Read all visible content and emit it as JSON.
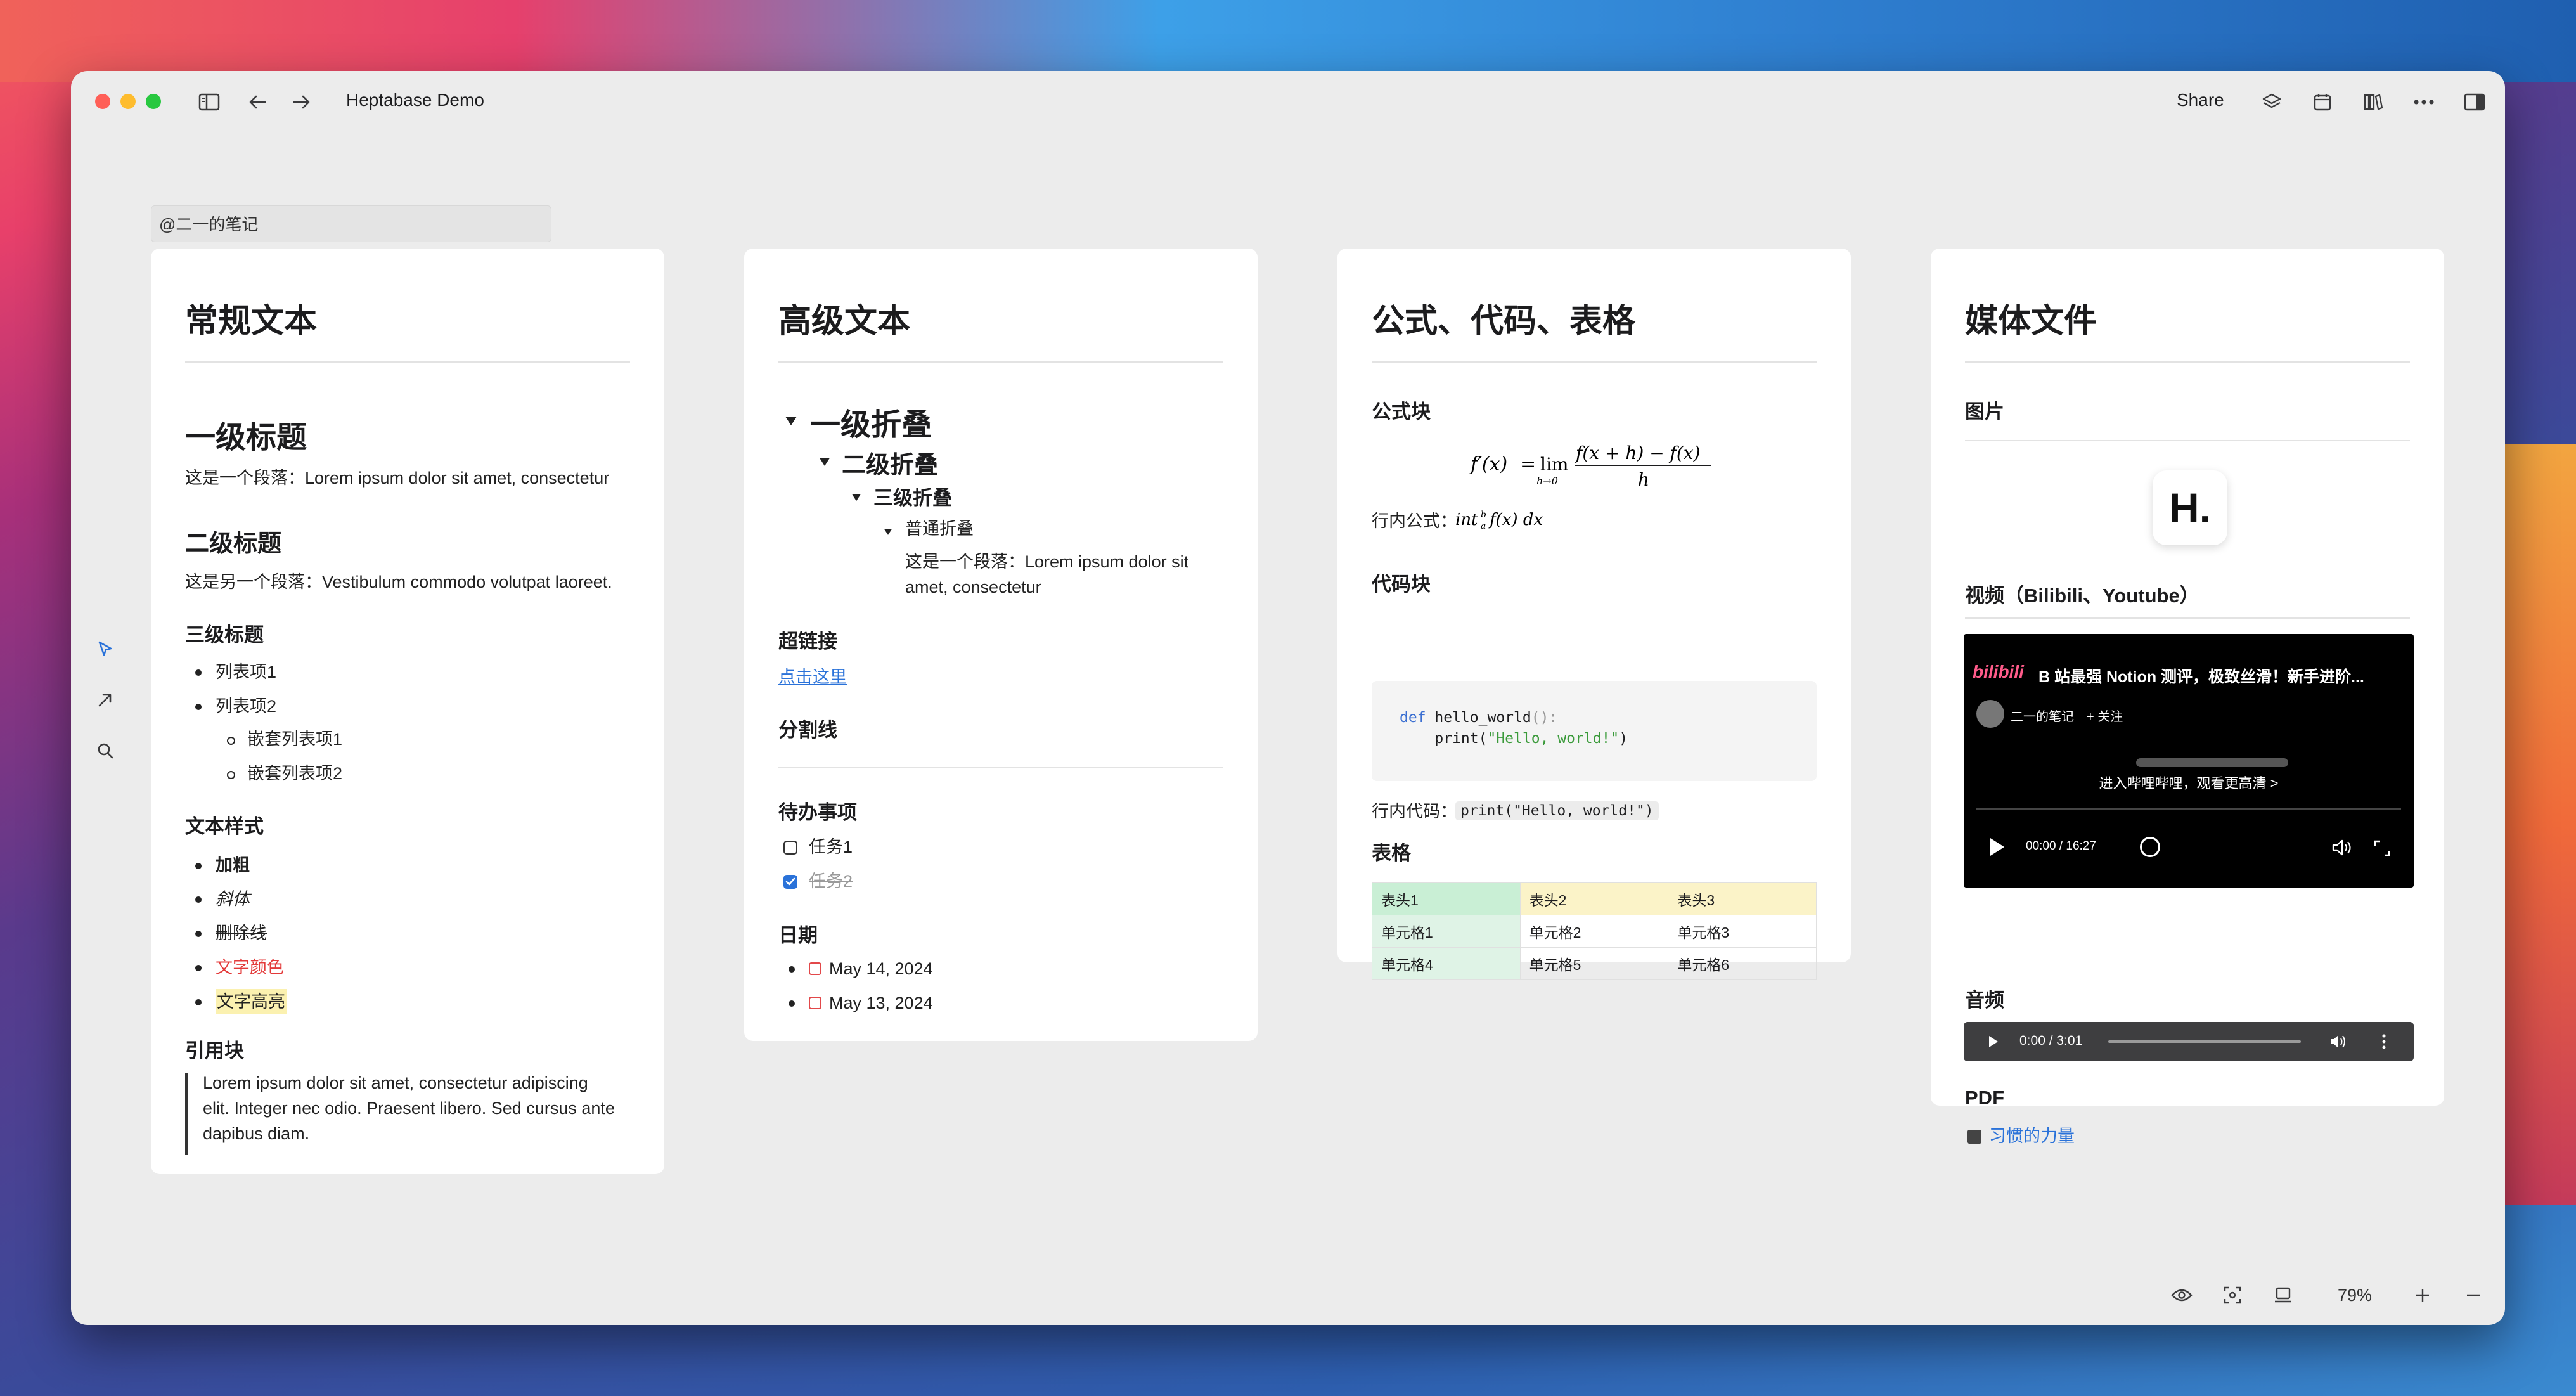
{
  "window": {
    "title": "Heptabase Demo",
    "share_label": "Share"
  },
  "mention": "@二一的笔记",
  "zoom": "79%",
  "card1": {
    "title": "常规文本",
    "h1": "一级标题",
    "p1": "这是一个段落：Lorem ipsum dolor sit amet, consectetur",
    "h2": "二级标题",
    "p2": "这是另一个段落：Vestibulum commodo volutpat laoreet.",
    "h3": "三级标题",
    "list": [
      "列表项1",
      "列表项2"
    ],
    "nested": [
      "嵌套列表项1",
      "嵌套列表项2"
    ],
    "styles_heading": "文本样式",
    "bold": "加粗",
    "italic": "斜体",
    "strike": "删除线",
    "color": "文字颜色",
    "highlight": "文字高亮",
    "quote_heading": "引用块",
    "quote": "Lorem ipsum dolor sit amet, consectetur adipiscing elit. Integer nec odio. Praesent libero. Sed cursus ante dapibus diam."
  },
  "card2": {
    "title": "高级文本",
    "fold1": "一级折叠",
    "fold2": "二级折叠",
    "fold3": "三级折叠",
    "fold4": "普通折叠",
    "fold_p": "这是一个段落：Lorem ipsum dolor sit amet, consectetur",
    "link_heading": "超链接",
    "link": "点击这里",
    "divider_heading": "分割线",
    "todo_heading": "待办事项",
    "todos": [
      {
        "label": "任务1",
        "done": false
      },
      {
        "label": "任务2",
        "done": true
      }
    ],
    "date_heading": "日期",
    "dates": [
      "May 14, 2024",
      "May 13, 2024"
    ]
  },
  "card3": {
    "title": "公式、代码、表格",
    "formula_heading": "公式块",
    "inline_formula_label": "行内公式：",
    "code_heading": "代码块",
    "code_line1_kw": "def",
    "code_line1_rest": " hello_world",
    "code_line1_paren": "():",
    "code_line2_fn": "    print(",
    "code_line2_str": "\"Hello, world!\"",
    "code_line2_end": ")",
    "inline_code_label": "行内代码：",
    "inline_code": "print(\"Hello, world!\")",
    "table_heading": "表格",
    "table_header": [
      "表头1",
      "表头2",
      "表头3"
    ],
    "table_rows": [
      [
        "单元格1",
        "单元格2",
        "单元格3"
      ],
      [
        "单元格4",
        "单元格5",
        "单元格6"
      ]
    ]
  },
  "card4": {
    "title": "媒体文件",
    "image_heading": "图片",
    "logo_text": "H.",
    "video_heading": "视频（Bilibili、Youtube）",
    "video_title": "B 站最强 Notion 测评，极致丝滑！新手进阶...",
    "video_channel": "二一的笔记",
    "video_follow": "+ 关注",
    "video_cta": "进入哔哩哔哩，观看更高清 >",
    "video_time": "00:00 / 16:27",
    "video_brand": "bilibili",
    "audio_heading": "音频",
    "audio_time": "0:00 / 3:01",
    "pdf_heading": "PDF",
    "pdf_link": "习惯的力量"
  },
  "colors": {
    "link": "#2a72d9",
    "red_text": "#e33a3a",
    "highlight": "#fbf1b0",
    "checkbox": "#2a72d9"
  }
}
